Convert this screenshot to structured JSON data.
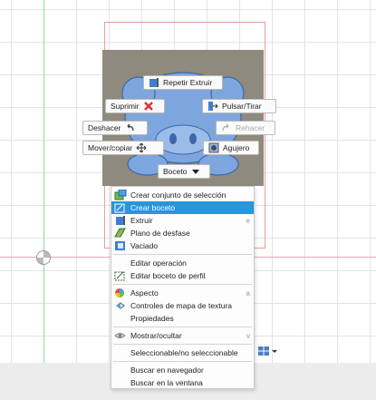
{
  "marking_menu": {
    "repetir_extruir": "Repetir Extruir",
    "suprimir": "Suprimir",
    "pulsar_tirar": "Pulsar/Tirar",
    "deshacer": "Deshacer",
    "rehacer": "Rehacer",
    "mover_copiar": "Mover/copiar",
    "agujero": "Agujero",
    "boceto": "Boceto"
  },
  "context_menu": {
    "items": [
      {
        "label": "Crear conjunto de selección",
        "shortcut": "",
        "icon": "selection-set-icon"
      },
      {
        "label": "Crear boceto",
        "shortcut": "",
        "icon": "create-sketch-icon",
        "highlighted": true
      },
      {
        "label": "Extruir",
        "shortcut": "e",
        "icon": "extrude-icon"
      },
      {
        "label": "Plano de desfase",
        "shortcut": "",
        "icon": "offset-plane-icon"
      },
      {
        "label": "Vaciado",
        "shortcut": "",
        "icon": "shell-icon"
      },
      {
        "label": "Editar operación",
        "shortcut": "",
        "icon": ""
      },
      {
        "label": "Editar boceto de perfil",
        "shortcut": "",
        "icon": "edit-profile-sketch-icon"
      },
      {
        "label": "Aspecto",
        "shortcut": "a",
        "icon": "appearance-icon"
      },
      {
        "label": "Controles de mapa de textura",
        "shortcut": "",
        "icon": "texture-map-icon"
      },
      {
        "label": "Propiedades",
        "shortcut": "",
        "icon": ""
      },
      {
        "label": "Mostrar/ocultar",
        "shortcut": "v",
        "icon": "eye-icon"
      },
      {
        "label": "Seleccionable/no seleccionable",
        "shortcut": "",
        "icon": ""
      },
      {
        "label": "Buscar en navegador",
        "shortcut": "",
        "icon": ""
      },
      {
        "label": "Buscar en la ventana",
        "shortcut": "",
        "icon": ""
      }
    ]
  },
  "colors": {
    "highlight": "#2a96d8",
    "model_blue": "#7ea6de",
    "panel": "#8f8a7e",
    "suprimir_x": "#e0312b"
  }
}
